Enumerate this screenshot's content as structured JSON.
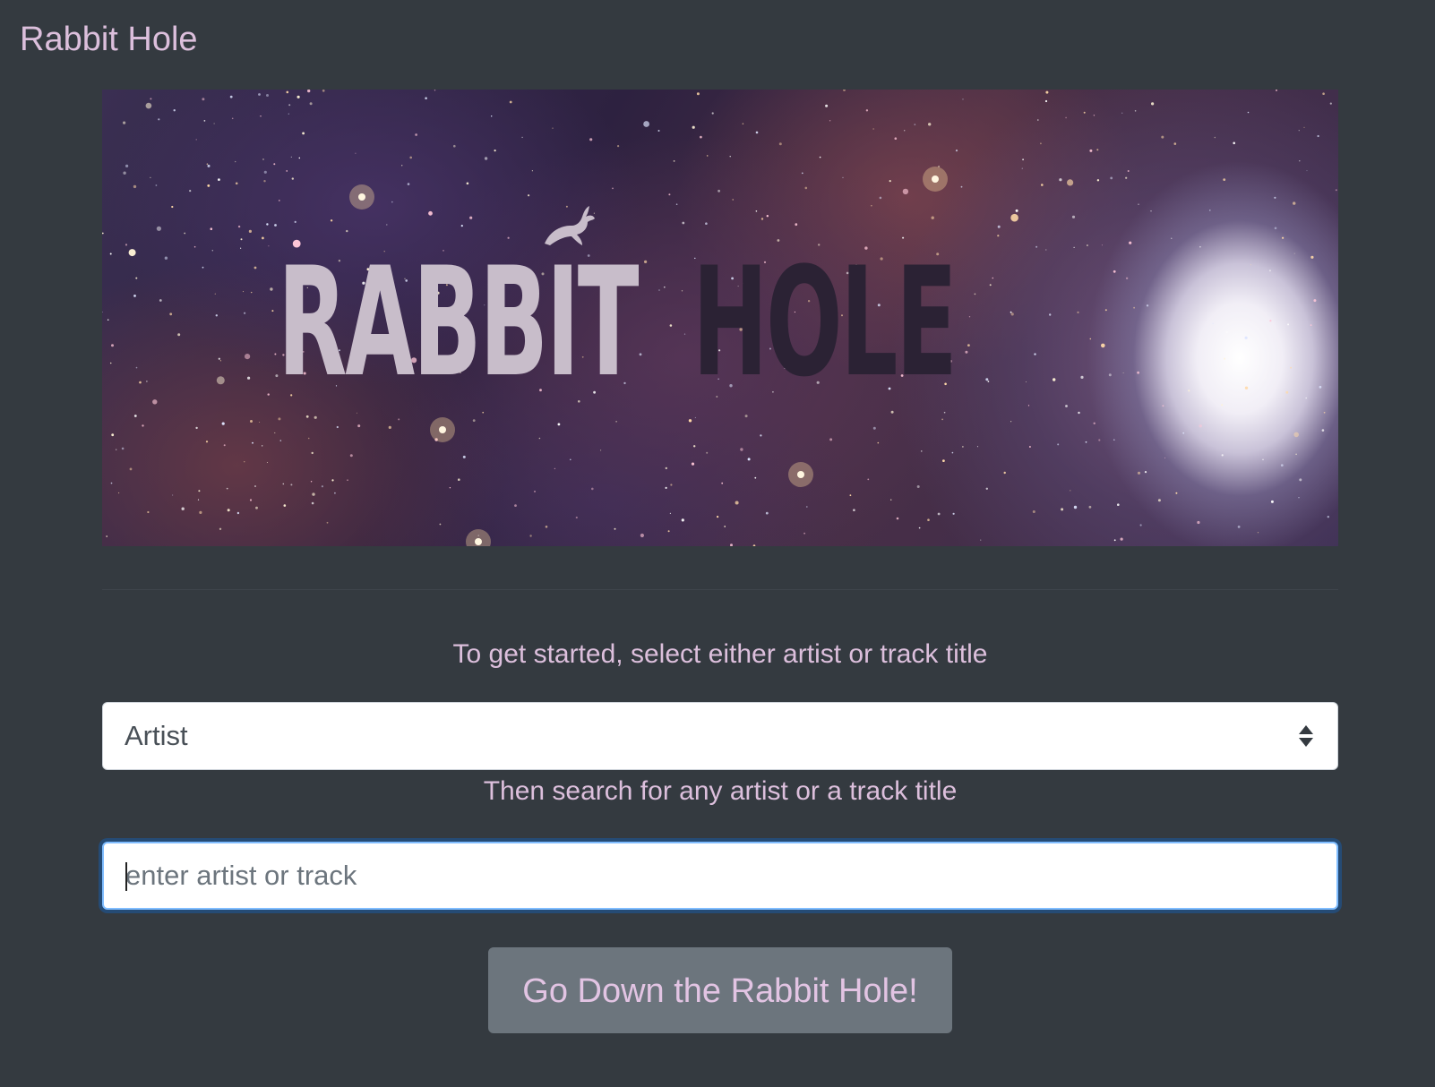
{
  "navbar": {
    "brand": "Rabbit Hole"
  },
  "banner": {
    "logo_word_1": "RABBIT",
    "logo_word_2": "HOLE"
  },
  "form": {
    "select_prompt": "To get started, select either artist or track title",
    "select_value": "Artist",
    "search_prompt": "Then search for any artist or a track title",
    "search_placeholder": "enter artist or track",
    "search_value": "",
    "submit_label": "Go Down the Rabbit Hole!"
  },
  "colors": {
    "background": "#343a40",
    "text_accent": "#dcbfdc",
    "button_bg": "#6c757d",
    "focus_ring": "#80bdff"
  },
  "icons": [
    "rabbit-icon",
    "select-arrows-icon"
  ]
}
